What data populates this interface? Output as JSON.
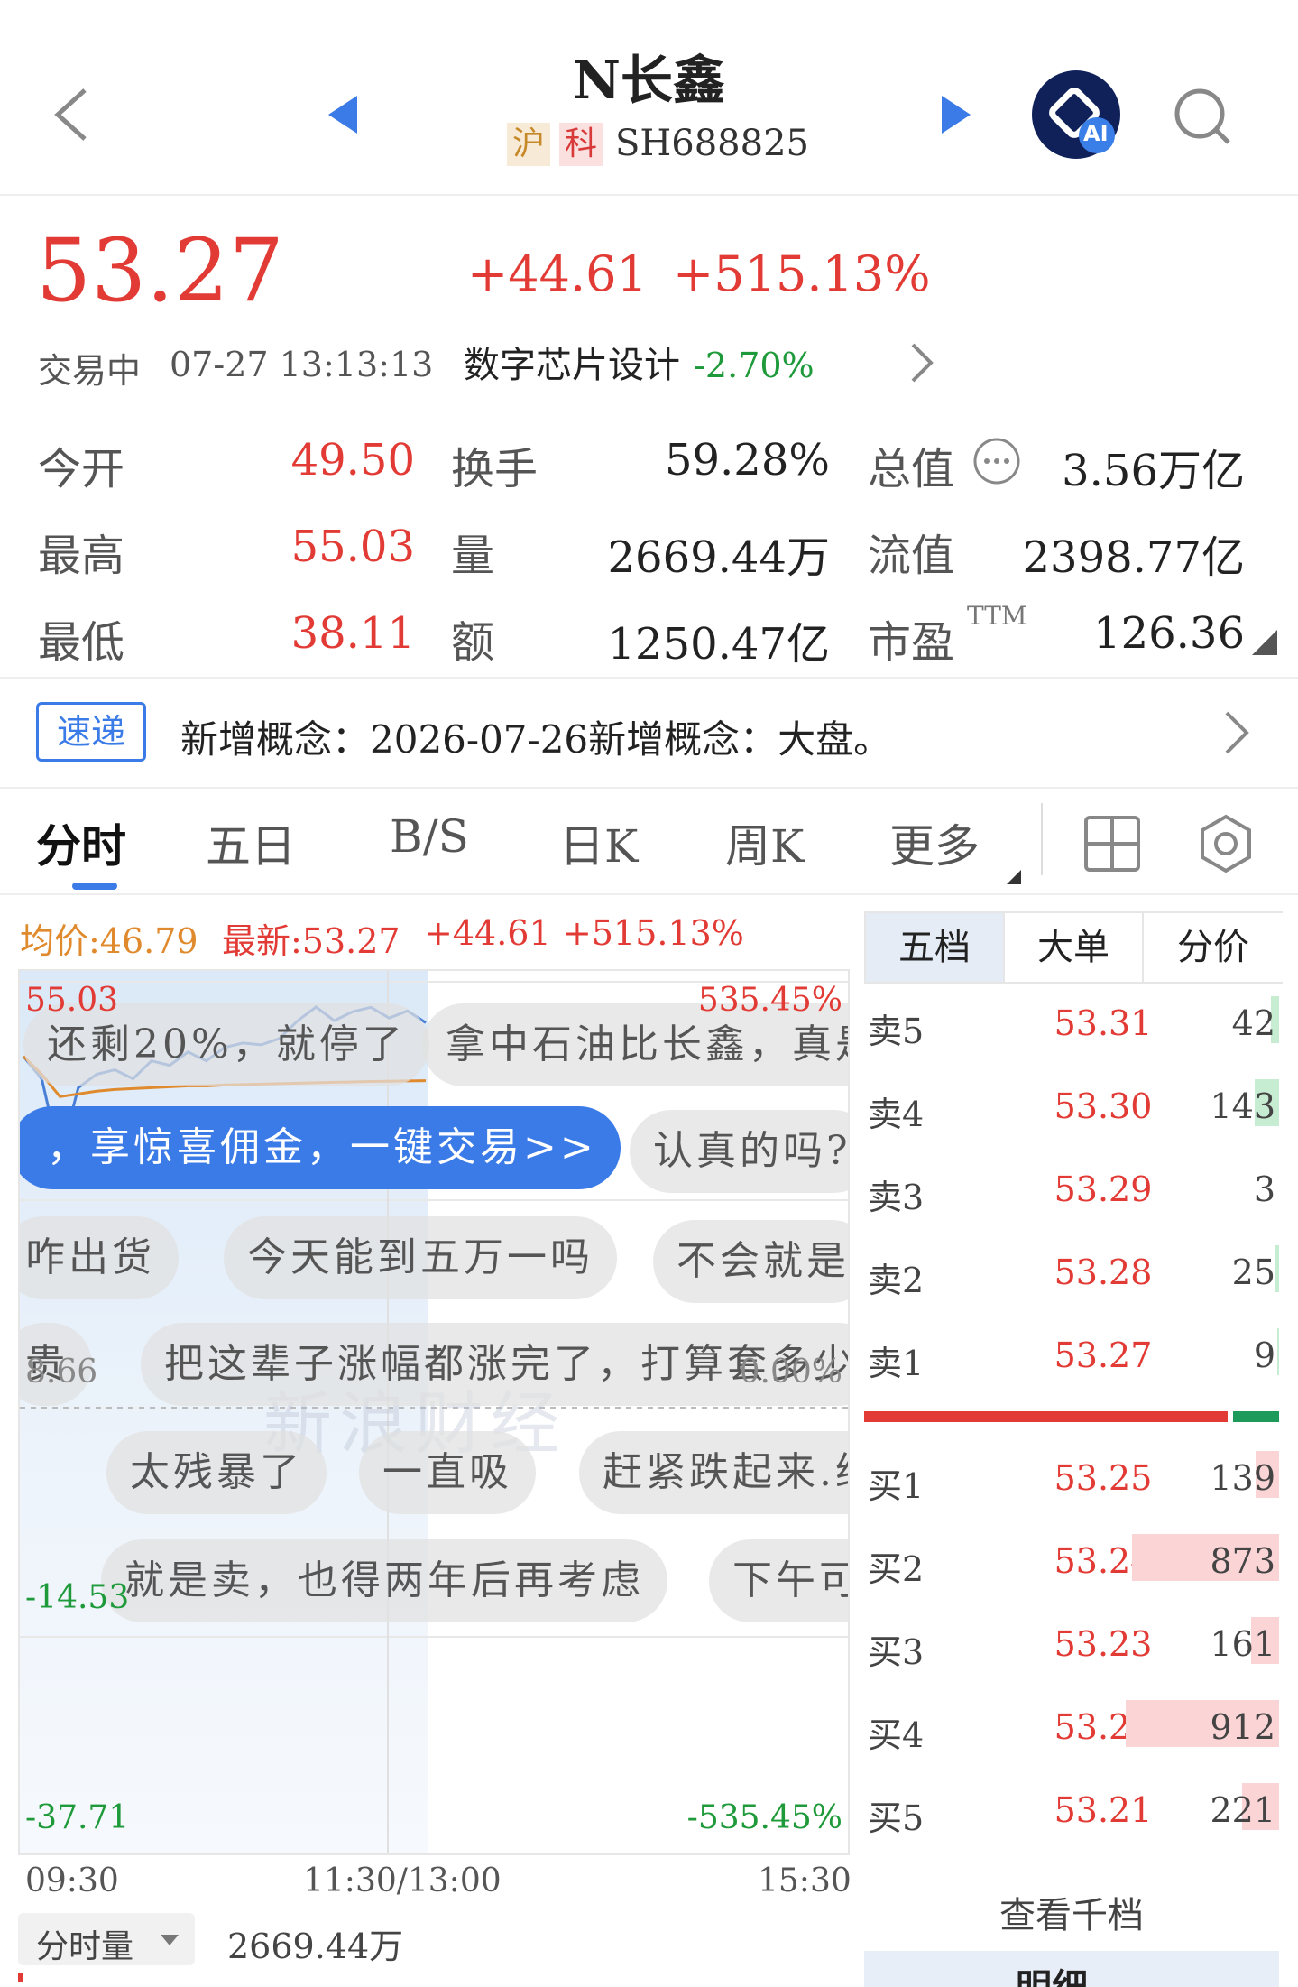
{
  "header": {
    "stock_name": "N长鑫",
    "market_tag": "沪",
    "board_tag": "科",
    "code": "SH688825",
    "ai_label": "AI"
  },
  "quote": {
    "price": "53.27",
    "change": "+44.61",
    "change_pct": "+515.13%",
    "status": "交易中",
    "datetime": "07-27 13:13:13",
    "sector": "数字芯片设计",
    "sector_change": "-2.70%"
  },
  "stats": [
    {
      "label": "今开",
      "value": "49.50"
    },
    {
      "label": "最高",
      "value": "55.03"
    },
    {
      "label": "最低",
      "value": "38.11"
    },
    {
      "label": "换手",
      "value": "59.28%"
    },
    {
      "label": "量",
      "value": "2669.44万"
    },
    {
      "label": "额",
      "value": "1250.47亿"
    },
    {
      "label": "总值",
      "value": "3.56万亿"
    },
    {
      "label": "流值",
      "value": "2398.77亿"
    },
    {
      "label": "市盈",
      "value": "126.36",
      "sup": "TTM"
    }
  ],
  "news": {
    "tag": "速递",
    "text": "新增概念：2026-07-26新增概念：大盘。"
  },
  "tabs": [
    "分时",
    "五日",
    "B/S",
    "日K",
    "周K",
    "更多"
  ],
  "active_tab": "分时",
  "chart_info": {
    "avg_label": "均价:46.79",
    "last_label": "最新:53.27",
    "change": "+44.61",
    "change_pct": "+515.13%"
  },
  "chart_data": {
    "type": "line",
    "x_ticks": [
      "09:30",
      "11:30/13:00",
      "15:30"
    ],
    "y_left_ticks": [
      "55.03",
      "8.66",
      "-14.53",
      "-37.71"
    ],
    "y_right_ticks": [
      "535.45%",
      "0.00%",
      "-535.45%"
    ],
    "series": [
      {
        "name": "最新",
        "color": "#4a7fd6",
        "values": [
          49.5,
          47,
          38.11,
          46,
          47.5,
          48,
          47,
          49,
          48.5,
          50,
          49,
          50.5,
          51,
          50.8,
          51.5,
          53.5,
          55.03,
          53.5,
          54.5,
          55,
          53.8,
          54.6,
          53.27
        ]
      },
      {
        "name": "均价",
        "color": "#e08a2e",
        "values": [
          49.5,
          47.5,
          45,
          45.3,
          45.6,
          45.8,
          45.9,
          46.0,
          46.1,
          46.2,
          46.2,
          46.3,
          46.35,
          46.4,
          46.45,
          46.5,
          46.55,
          46.6,
          46.65,
          46.7,
          46.73,
          46.76,
          46.79
        ]
      }
    ],
    "ylim": [
      -37.71,
      55.03
    ]
  },
  "volume": {
    "selector": "分时量",
    "value": "2669.44万"
  },
  "danmaku": [
    "还剩20%，就停了",
    "拿中石油比长鑫，真是",
    "，享惊喜佣金，一键交易>>",
    "认真的吗?",
    "咋出货",
    "今天能到五万一吗",
    "不会就是",
    "贵",
    "把这辈子涨幅都涨完了，打算套多少",
    "太残暴了",
    "一直吸",
    "赶紧跌起来.给",
    "就是卖，也得两年后再考虑",
    "下午可"
  ],
  "watermark": "新浪财经",
  "orderbook": {
    "tabs": [
      "五档",
      "大单",
      "分价"
    ],
    "sell": [
      {
        "label": "卖5",
        "price": "53.31",
        "vol": "42",
        "bar": 0.05
      },
      {
        "label": "卖4",
        "price": "53.30",
        "vol": "143",
        "bar": 0.16
      },
      {
        "label": "卖3",
        "price": "53.29",
        "vol": "3",
        "bar": 0.0
      },
      {
        "label": "卖2",
        "price": "53.28",
        "vol": "25",
        "bar": 0.03
      },
      {
        "label": "卖1",
        "price": "53.27",
        "vol": "9",
        "bar": 0.01
      }
    ],
    "buy": [
      {
        "label": "买1",
        "price": "53.25",
        "vol": "139",
        "bar": 0.15
      },
      {
        "label": "买2",
        "price": "53.24",
        "vol": "873",
        "bar": 0.96
      },
      {
        "label": "买3",
        "price": "53.23",
        "vol": "161",
        "bar": 0.18
      },
      {
        "label": "买4",
        "price": "53.22",
        "vol": "912",
        "bar": 1.0
      },
      {
        "label": "买5",
        "price": "53.21",
        "vol": "221",
        "bar": 0.24
      }
    ],
    "ratio": 0.89,
    "more": "查看千档",
    "detail": "明细"
  }
}
